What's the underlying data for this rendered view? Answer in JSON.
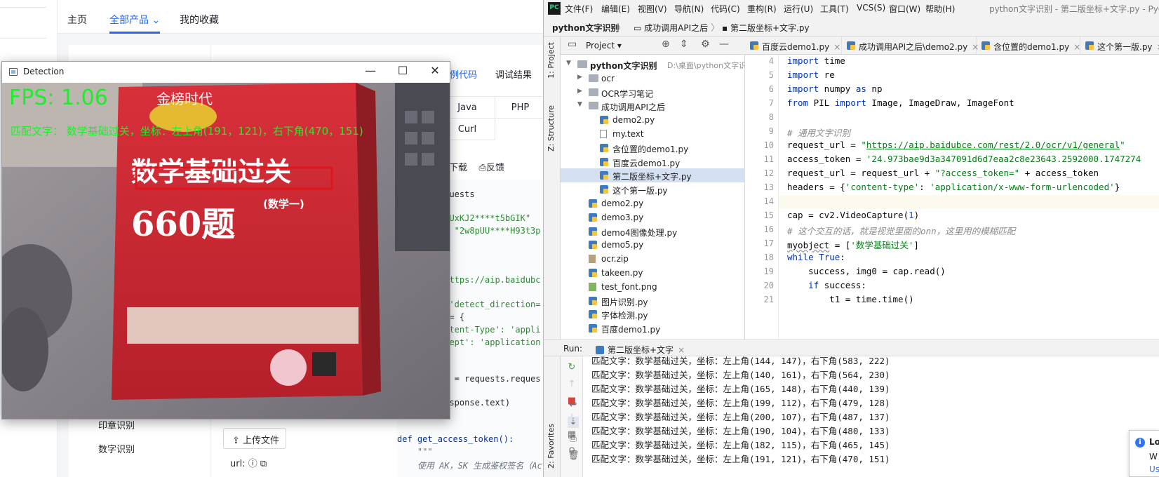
{
  "web": {
    "nav": [
      "主页",
      "全部产品",
      "我的收藏"
    ],
    "tabs": [
      "示例代码",
      "调试结果"
    ],
    "languages": [
      "Java",
      "PHP",
      "Curl"
    ],
    "actions": [
      "下载",
      "反馈"
    ],
    "side_items": [
      "印章识别",
      "数字识别"
    ],
    "upload_label": "上传文件",
    "url_label": "url:",
    "code_lines": [
      {
        "text": "equests",
        "cls": ""
      },
      {
        "text": "\"LUxKJ2****t5bGIK\"",
        "cls": "str"
      },
      {
        "text": " = \"2w8pUU****H93t3p",
        "cls": "str"
      },
      {
        "text": ":",
        "cls": ""
      },
      {
        "text": "\"https://aip.baidubc",
        "cls": "str"
      },
      {
        "text": "d='detect_direction=",
        "cls": "str"
      },
      {
        "text": "s = {",
        "cls": ""
      },
      {
        "text": "ontent-Type': 'appli",
        "cls": "str"
      },
      {
        "text": "ccept': 'application",
        "cls": "str"
      },
      {
        "text": "se = requests.reques",
        "cls": ""
      },
      {
        "text": "response.text)",
        "cls": ""
      },
      {
        "text": "def get_access_token():",
        "cls": "kw"
      },
      {
        "text": "    \"\"\"",
        "cls": "cm"
      },
      {
        "text": "    使用 AK，SK 生成鉴权签名（Ac",
        "cls": "cm"
      }
    ]
  },
  "detection": {
    "title": "Detection",
    "fps": "FPS: 1.06",
    "match": "匹配文字：  数学基础过关，坐标：左上角(191，121)，右下角(470，151)",
    "book_title": "数学基础过关",
    "book_number": "660题",
    "book_brand": "金榜时代",
    "book_sub": "(数学一)"
  },
  "ide": {
    "menu": [
      "文件(F)",
      "编辑(E)",
      "视图(V)",
      "导航(N)",
      "代码(C)",
      "重构(R)",
      "运行(U)",
      "工具(T)",
      "VCS(S)",
      "窗口(W)",
      "帮助(H)"
    ],
    "window_title": "python文字识别 - 第二版坐标+文字.py - PyC",
    "breadcrumbs": [
      "python文字识别",
      "成功调用API之后",
      "第二版坐标+文字.py"
    ],
    "project_label": "Project",
    "tool_labels": [
      "1: Project",
      "Z: Structure",
      "2: Favorites"
    ],
    "tree": [
      {
        "indent": 0,
        "arrow": "▼",
        "icon": "folder",
        "label": "python文字识别",
        "path": "D:\\桌面\\python文字识",
        "bold": true
      },
      {
        "indent": 1,
        "arrow": "▶",
        "icon": "folder",
        "label": "ocr"
      },
      {
        "indent": 1,
        "arrow": "▶",
        "icon": "folder",
        "label": "OCR学习笔记"
      },
      {
        "indent": 1,
        "arrow": "▼",
        "icon": "folder",
        "label": "成功调用API之后"
      },
      {
        "indent": 2,
        "arrow": "",
        "icon": "py",
        "label": "demo2.py"
      },
      {
        "indent": 2,
        "arrow": "",
        "icon": "txt",
        "label": "my.text"
      },
      {
        "indent": 2,
        "arrow": "",
        "icon": "py",
        "label": "含位置的demo1.py"
      },
      {
        "indent": 2,
        "arrow": "",
        "icon": "py",
        "label": "百度云demo1.py"
      },
      {
        "indent": 2,
        "arrow": "",
        "icon": "py",
        "label": "第二版坐标+文字.py",
        "selected": true
      },
      {
        "indent": 2,
        "arrow": "",
        "icon": "py",
        "label": "这个第一版.py"
      },
      {
        "indent": 1,
        "arrow": "",
        "icon": "py",
        "label": "demo2.py"
      },
      {
        "indent": 1,
        "arrow": "",
        "icon": "py",
        "label": "demo3.py"
      },
      {
        "indent": 1,
        "arrow": "",
        "icon": "py",
        "label": "demo4图像处理.py"
      },
      {
        "indent": 1,
        "arrow": "",
        "icon": "py",
        "label": "demo5.py"
      },
      {
        "indent": 1,
        "arrow": "",
        "icon": "zip",
        "label": "ocr.zip"
      },
      {
        "indent": 1,
        "arrow": "",
        "icon": "py",
        "label": "takeen.py"
      },
      {
        "indent": 1,
        "arrow": "",
        "icon": "img",
        "label": "test_font.png"
      },
      {
        "indent": 1,
        "arrow": "",
        "icon": "py",
        "label": "图片识别.py"
      },
      {
        "indent": 1,
        "arrow": "",
        "icon": "py",
        "label": "字体检测.py"
      },
      {
        "indent": 1,
        "arrow": "",
        "icon": "py",
        "label": "百度demo1.py"
      }
    ],
    "tabs": [
      "百度云demo1.py",
      "成功调用API之后\\demo2.py",
      "含位置的demo1.py",
      "这个第一版.py"
    ],
    "line_numbers": [
      "4",
      "5",
      "6",
      "7",
      "8",
      "9",
      "10",
      "11",
      "12",
      "13",
      "14",
      "15",
      "16",
      "17",
      "18",
      "19",
      "20",
      "21"
    ],
    "code": [
      [
        {
          "t": "import",
          "c": "kw"
        },
        {
          "t": " time",
          "c": ""
        }
      ],
      [
        {
          "t": "import",
          "c": "kw"
        },
        {
          "t": " re",
          "c": ""
        }
      ],
      [
        {
          "t": "import",
          "c": "kw"
        },
        {
          "t": " numpy ",
          "c": ""
        },
        {
          "t": "as",
          "c": "kw"
        },
        {
          "t": " np",
          "c": ""
        }
      ],
      [
        {
          "t": "from",
          "c": "kw"
        },
        {
          "t": " PIL ",
          "c": ""
        },
        {
          "t": "import",
          "c": "kw"
        },
        {
          "t": " Image, ImageDraw, ImageFont",
          "c": ""
        }
      ],
      [],
      [
        {
          "t": "# 通用文字识别",
          "c": "cm"
        }
      ],
      [
        {
          "t": "request_url = ",
          "c": ""
        },
        {
          "t": "\"",
          "c": "st"
        },
        {
          "t": "https://aip.baidubce.com/rest/2.0/ocr/v1/general",
          "c": "ul"
        },
        {
          "t": "\"",
          "c": "st"
        }
      ],
      [
        {
          "t": "access_token = ",
          "c": ""
        },
        {
          "t": "'24.973bae9d3a347091d6d7eaa2c8e23643.2592000.1747274",
          "c": "st"
        }
      ],
      [
        {
          "t": "request_url = request_url + ",
          "c": ""
        },
        {
          "t": "\"?access_token=\"",
          "c": "st"
        },
        {
          "t": " + access_token",
          "c": ""
        }
      ],
      [
        {
          "t": "headers = {",
          "c": ""
        },
        {
          "t": "'content-type'",
          "c": "st"
        },
        {
          "t": ": ",
          "c": ""
        },
        {
          "t": "'application/x-www-form-urlencoded'",
          "c": "st"
        },
        {
          "t": "}",
          "c": ""
        }
      ],
      [],
      [
        {
          "t": "cap = cv2.VideoCapture(",
          "c": ""
        },
        {
          "t": "1",
          "c": "nm"
        },
        {
          "t": ")",
          "c": ""
        }
      ],
      [
        {
          "t": "# 这个交互的话，就是视觉里面的onn，这里用的模糊匹配",
          "c": "cm"
        }
      ],
      [
        {
          "t": "myobject",
          "c": "sq"
        },
        {
          "t": " = [",
          "c": ""
        },
        {
          "t": "'数学基础过关'",
          "c": "st"
        },
        {
          "t": "]",
          "c": ""
        }
      ],
      [
        {
          "t": "while",
          "c": "kw"
        },
        {
          "t": " ",
          "c": ""
        },
        {
          "t": "True",
          "c": "kw"
        },
        {
          "t": ":",
          "c": ""
        }
      ],
      [
        {
          "t": "    success, img0 = cap.read()",
          "c": ""
        }
      ],
      [
        {
          "t": "    ",
          "c": ""
        },
        {
          "t": "if",
          "c": "kw"
        },
        {
          "t": " success:",
          "c": ""
        }
      ],
      [
        {
          "t": "        t1 = time.time()",
          "c": ""
        }
      ]
    ],
    "run_label": "Run:",
    "run_tab": "第二版坐标+文字",
    "output": [
      "匹配文字：数学基础过关，坐标：左上角(144, 147)，右下角(583, 222)",
      "匹配文字：数学基础过关，坐标：左上角(140, 161)，右下角(564, 230)",
      "匹配文字：数学基础过关，坐标：左上角(165, 148)，右下角(440, 139)",
      "匹配文字：数学基础过关，坐标：左上角(199, 112)，右下角(479, 128)",
      "匹配文字：数学基础过关，坐标：左上角(200, 107)，右下角(487, 137)",
      "匹配文字：数学基础过关，坐标：左上角(190, 104)，右下角(480, 133)",
      "匹配文字：数学基础过关，坐标：左上角(182, 115)，右下角(465, 145)",
      "匹配文字：数学基础过关，坐标：左上角(191, 121)，右下角(470, 151)"
    ],
    "notif_title": "Lo",
    "notif_body": "W",
    "notif_link": "Us"
  }
}
